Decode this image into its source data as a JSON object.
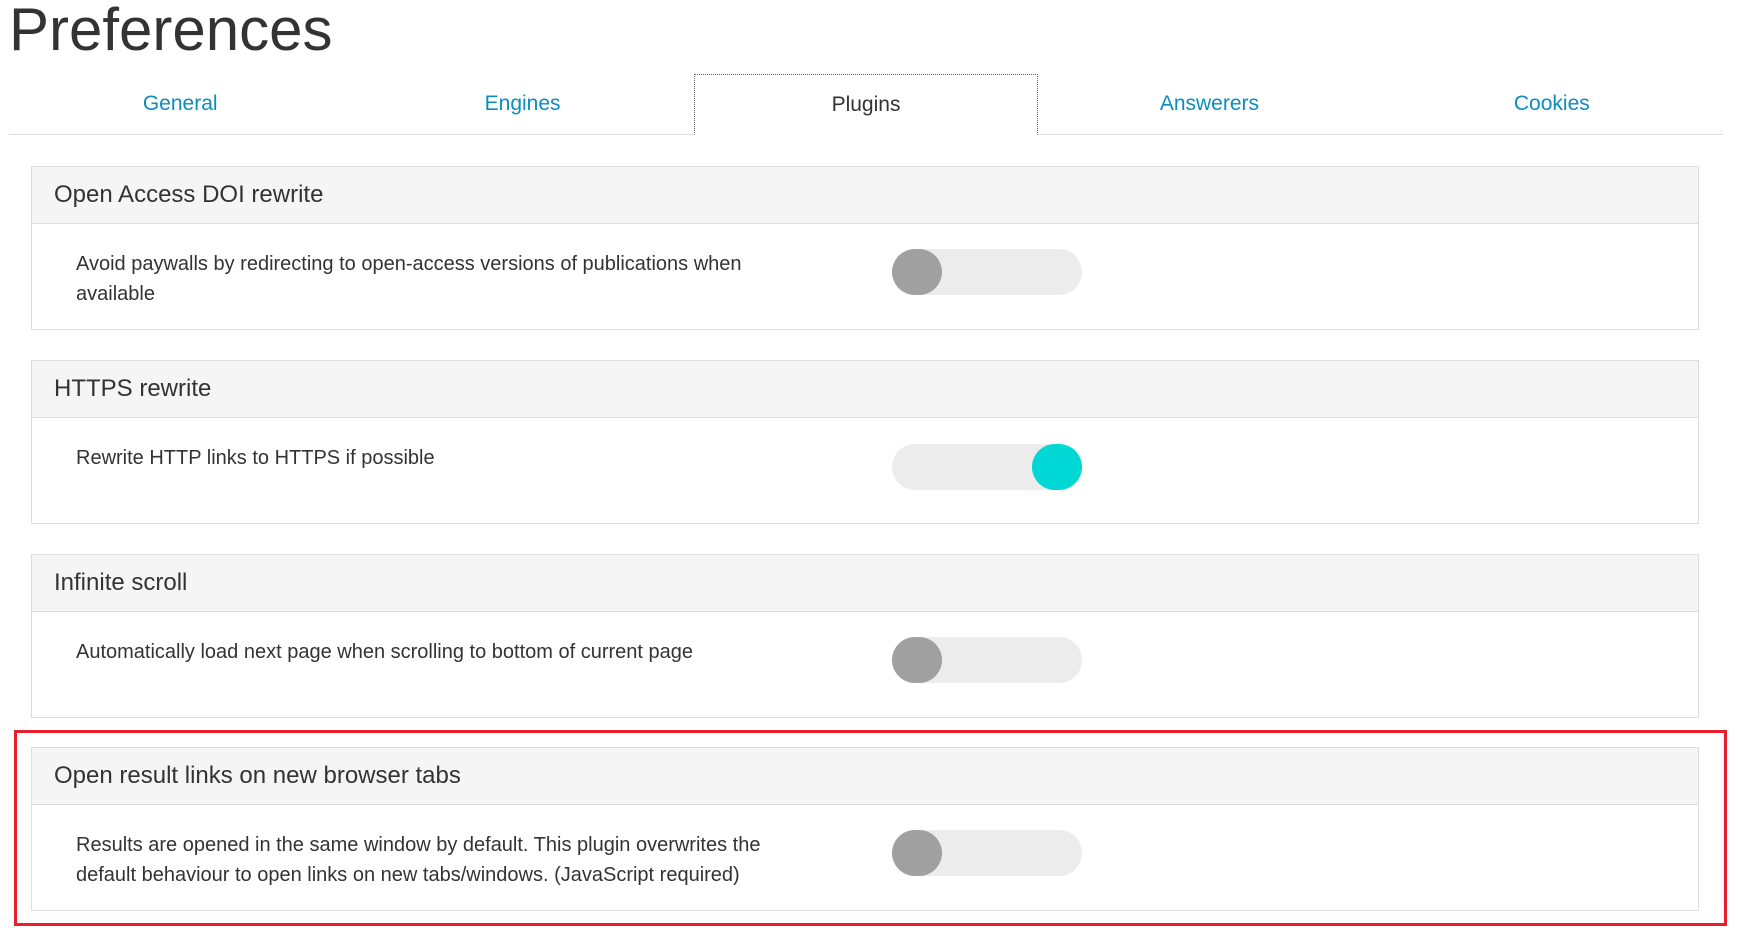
{
  "page": {
    "title": "Preferences"
  },
  "tabs": [
    {
      "label": "General",
      "active": false
    },
    {
      "label": "Engines",
      "active": false
    },
    {
      "label": "Plugins",
      "active": true
    },
    {
      "label": "Answerers",
      "active": false
    },
    {
      "label": "Cookies",
      "active": false
    }
  ],
  "plugins": [
    {
      "title": "Open Access DOI rewrite",
      "description": "Avoid paywalls by redirecting to open-access versions of publications when available",
      "enabled": false
    },
    {
      "title": "HTTPS rewrite",
      "description": "Rewrite HTTP links to HTTPS if possible",
      "enabled": true
    },
    {
      "title": "Infinite scroll",
      "description": "Automatically load next page when scrolling to bottom of current page",
      "enabled": false
    },
    {
      "title": "Open result links on new browser tabs",
      "description": "Results are opened in the same window by default. This plugin overwrites the default behaviour to open links on new tabs/windows. (JavaScript required)",
      "enabled": false
    }
  ],
  "colors": {
    "link": "#0c8dbd",
    "toggle_on": "#01d7d4",
    "toggle_off_knob": "#a0a0a0",
    "toggle_track": "#ececec",
    "highlight_box": "#e8202d"
  }
}
